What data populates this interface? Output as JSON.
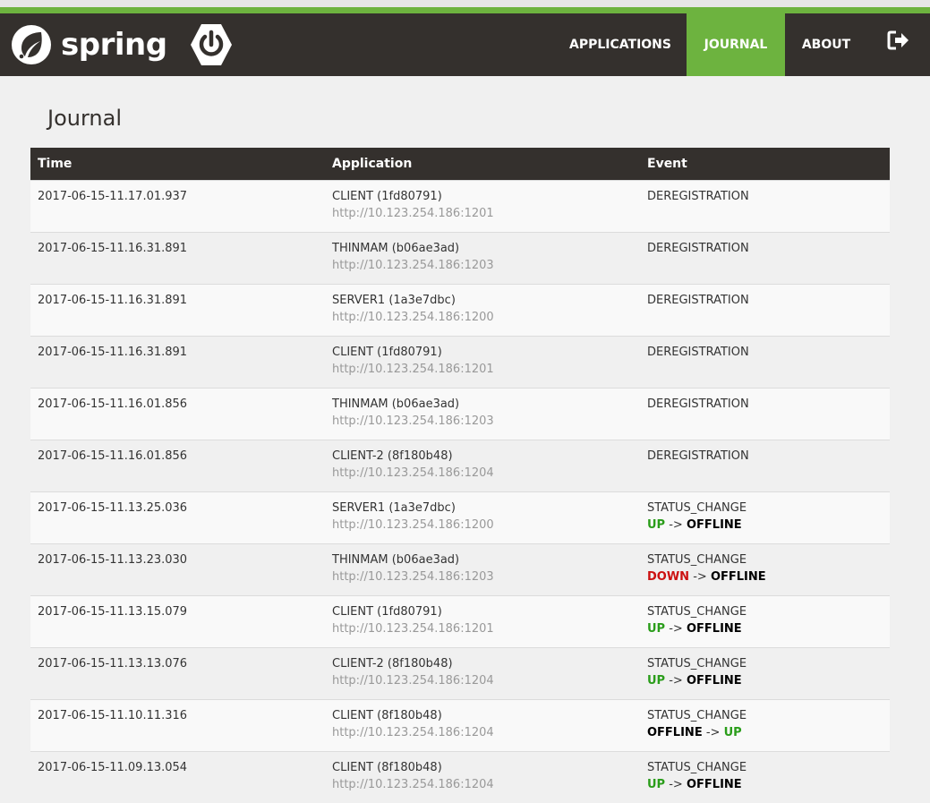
{
  "brand": {
    "name": "spring"
  },
  "nav": {
    "applications": "APPLICATIONS",
    "journal": "JOURNAL",
    "about": "ABOUT",
    "logout_icon": "sign-out-icon"
  },
  "page": {
    "title": "Journal"
  },
  "table": {
    "headers": {
      "time": "Time",
      "application": "Application",
      "event": "Event"
    },
    "arrow": "->",
    "rows": [
      {
        "time": "2017-06-15-11.17.01.937",
        "app": "CLIENT (1fd80791)",
        "url": "http://10.123.254.186:1201",
        "event": "DEREGISTRATION"
      },
      {
        "time": "2017-06-15-11.16.31.891",
        "app": "THINMAM (b06ae3ad)",
        "url": "http://10.123.254.186:1203",
        "event": "DEREGISTRATION"
      },
      {
        "time": "2017-06-15-11.16.31.891",
        "app": "SERVER1 (1a3e7dbc)",
        "url": "http://10.123.254.186:1200",
        "event": "DEREGISTRATION"
      },
      {
        "time": "2017-06-15-11.16.31.891",
        "app": "CLIENT (1fd80791)",
        "url": "http://10.123.254.186:1201",
        "event": "DEREGISTRATION"
      },
      {
        "time": "2017-06-15-11.16.01.856",
        "app": "THINMAM (b06ae3ad)",
        "url": "http://10.123.254.186:1203",
        "event": "DEREGISTRATION"
      },
      {
        "time": "2017-06-15-11.16.01.856",
        "app": "CLIENT-2 (8f180b48)",
        "url": "http://10.123.254.186:1204",
        "event": "DEREGISTRATION"
      },
      {
        "time": "2017-06-15-11.13.25.036",
        "app": "SERVER1 (1a3e7dbc)",
        "url": "http://10.123.254.186:1200",
        "event": "STATUS_CHANGE",
        "from": "UP",
        "to": "OFFLINE"
      },
      {
        "time": "2017-06-15-11.13.23.030",
        "app": "THINMAM (b06ae3ad)",
        "url": "http://10.123.254.186:1203",
        "event": "STATUS_CHANGE",
        "from": "DOWN",
        "to": "OFFLINE"
      },
      {
        "time": "2017-06-15-11.13.15.079",
        "app": "CLIENT (1fd80791)",
        "url": "http://10.123.254.186:1201",
        "event": "STATUS_CHANGE",
        "from": "UP",
        "to": "OFFLINE"
      },
      {
        "time": "2017-06-15-11.13.13.076",
        "app": "CLIENT-2 (8f180b48)",
        "url": "http://10.123.254.186:1204",
        "event": "STATUS_CHANGE",
        "from": "UP",
        "to": "OFFLINE"
      },
      {
        "time": "2017-06-15-11.10.11.316",
        "app": "CLIENT (8f180b48)",
        "url": "http://10.123.254.186:1204",
        "event": "STATUS_CHANGE",
        "from": "OFFLINE",
        "to": "UP"
      },
      {
        "time": "2017-06-15-11.09.13.054",
        "app": "CLIENT (8f180b48)",
        "url": "http://10.123.254.186:1204",
        "event": "STATUS_CHANGE",
        "from": "UP",
        "to": "OFFLINE"
      }
    ]
  },
  "colors": {
    "brand_green": "#6db33f",
    "navbar_dark": "#34302d",
    "status_up": "#2a9d1a",
    "status_down": "#cc1111",
    "status_offline": "#000000"
  }
}
